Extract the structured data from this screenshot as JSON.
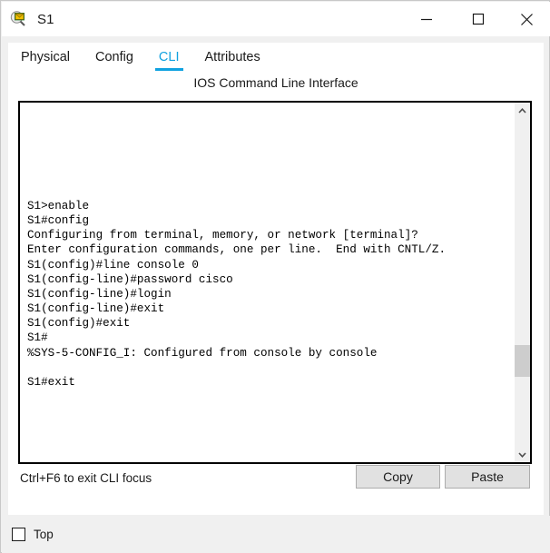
{
  "window": {
    "title": "S1",
    "icon": "magnifier-device-icon",
    "controls": {
      "minimize": "minimize-icon",
      "maximize": "maximize-icon",
      "close": "close-icon"
    }
  },
  "tabs": [
    {
      "label": "Physical",
      "active": false
    },
    {
      "label": "Config",
      "active": false
    },
    {
      "label": "CLI",
      "active": true
    },
    {
      "label": "Attributes",
      "active": false
    }
  ],
  "cli": {
    "caption": "IOS Command Line Interface",
    "lines": [
      "S1>enable",
      "S1#config",
      "Configuring from terminal, memory, or network [terminal]?",
      "Enter configuration commands, one per line.  End with CNTL/Z.",
      "S1(config)#line console 0",
      "S1(config-line)#password cisco",
      "S1(config-line)#login",
      "S1(config-line)#exit",
      "S1(config)#exit",
      "S1#",
      "%SYS-5-CONFIG_I: Configured from console by console",
      "",
      "S1#exit"
    ],
    "text": "S1>enable\nS1#config\nConfiguring from terminal, memory, or network [terminal]?\nEnter configuration commands, one per line.  End with CNTL/Z.\nS1(config)#line console 0\nS1(config-line)#password cisco\nS1(config-line)#login\nS1(config-line)#exit\nS1(config)#exit\nS1#\n%SYS-5-CONFIG_I: Configured from console by console\n\nS1#exit",
    "scrollbar": {
      "up_arrow": "chevron-up-icon",
      "down_arrow": "chevron-down-icon"
    }
  },
  "footer": {
    "hint": "Ctrl+F6 to exit CLI focus",
    "copy_label": "Copy",
    "paste_label": "Paste"
  },
  "bottom": {
    "top_label": "Top",
    "top_checked": false
  },
  "colors": {
    "accent": "#10a2e0",
    "window_bg": "#f0f0f0",
    "panel_bg": "#ffffff",
    "terminal_fg": "#000000",
    "button_bg": "#e1e1e1",
    "scroll_thumb": "#cdcdcd"
  }
}
